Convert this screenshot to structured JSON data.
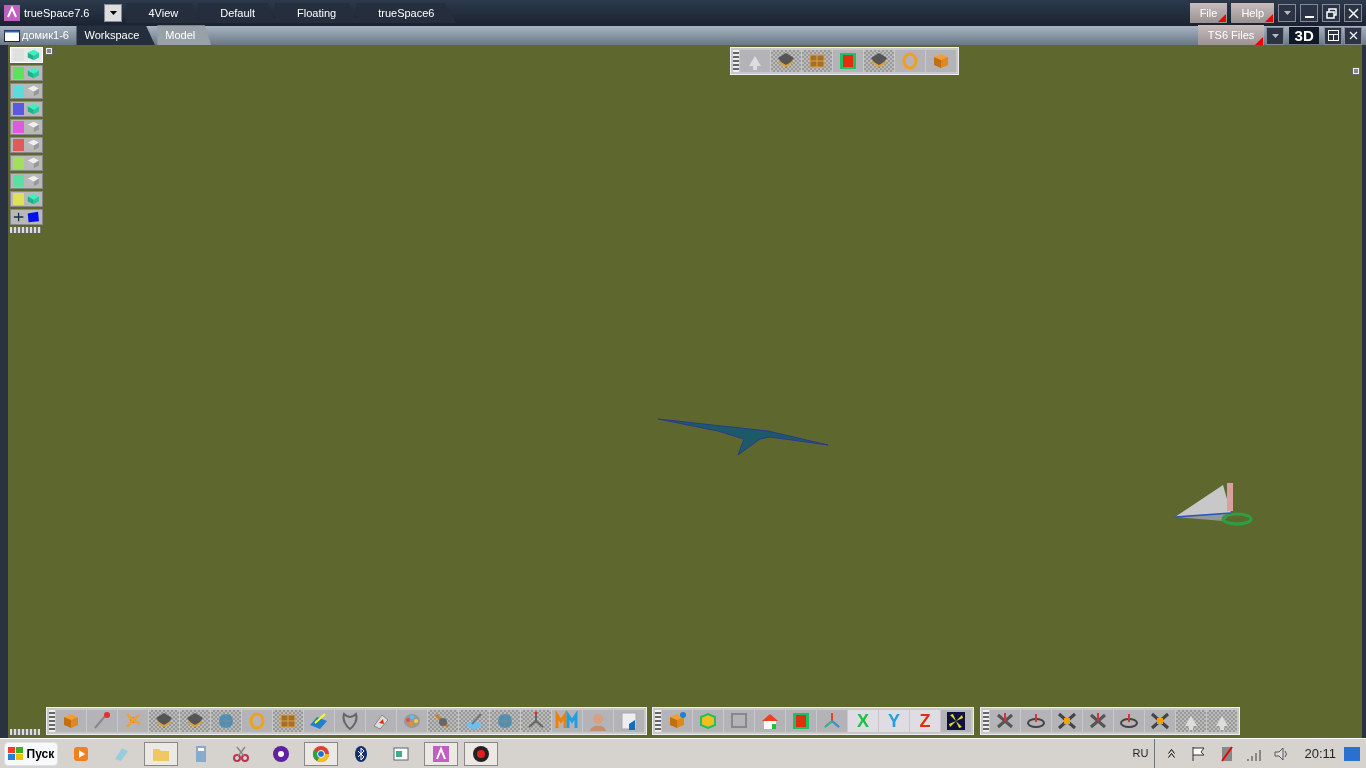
{
  "window": {
    "title": "trueSpace7.6"
  },
  "layout_tabs": [
    {
      "label": "4View",
      "selected": false
    },
    {
      "label": "Default",
      "selected": false
    },
    {
      "label": "Floating",
      "selected": false
    },
    {
      "label": "trueSpace6",
      "selected": false
    }
  ],
  "menu": [
    "File",
    "Help"
  ],
  "document": {
    "title": "домик1-6"
  },
  "view_tabs": [
    {
      "label": "Workspace",
      "selected": true
    },
    {
      "label": "Model",
      "selected": false
    }
  ],
  "library_dropdown": "TS6 Files",
  "view_mode": "3D",
  "palette": [
    {
      "color": "#e0e0e0",
      "active": true,
      "selected": true
    },
    {
      "color": "#5ee05a",
      "active": true,
      "selected": false
    },
    {
      "color": "#5adcdc",
      "active": false,
      "selected": false
    },
    {
      "color": "#5a5ae0",
      "active": true,
      "selected": false
    },
    {
      "color": "#e05ae0",
      "active": false,
      "selected": false
    },
    {
      "color": "#e05a5a",
      "active": false,
      "selected": false
    },
    {
      "color": "#a0e05a",
      "active": false,
      "selected": false
    },
    {
      "color": "#5ae0a0",
      "active": false,
      "selected": false
    },
    {
      "color": "#e0e05a",
      "active": true,
      "selected": false
    }
  ],
  "axis_buttons": [
    "X",
    "Y",
    "Z"
  ],
  "taskbar": {
    "start": "Пуск",
    "language": "RU",
    "clock": "20:11"
  }
}
